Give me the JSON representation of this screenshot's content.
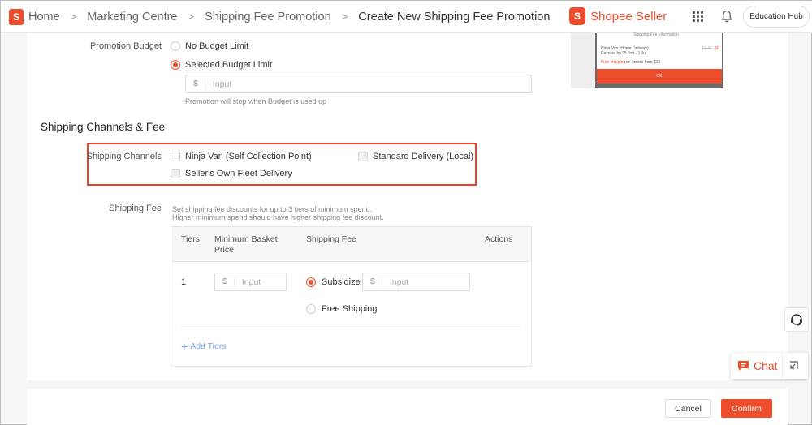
{
  "header": {
    "breadcrumb": [
      "Home",
      "Marketing Centre",
      "Shipping Fee Promotion",
      "Create New Shipping Fee Promotion"
    ],
    "brand": "Shopee Seller",
    "education_hub": "Education Hub"
  },
  "budget": {
    "label": "Promotion Budget",
    "option_no_limit": "No Budget Limit",
    "option_selected": "Selected Budget Limit",
    "currency": "$",
    "placeholder": "Input",
    "hint": "Promotion will stop when Budget is used up"
  },
  "channels_section": {
    "title": "Shipping Channels & Fee",
    "label": "Shipping Channels",
    "options": [
      "Ninja Van (Self Collection Point)",
      "Standard Delivery (Local)",
      "Seller's Own Fleet Delivery"
    ]
  },
  "fee": {
    "label": "Shipping Fee",
    "hint_line1": "Set shipping fee discounts for up to 3 tiers of minimum spend.",
    "hint_line2": "Higher minimum spend should have higher shipping fee discount.",
    "columns": [
      "Tiers",
      "Minimum Basket Price",
      "Shipping Fee",
      "Actions"
    ],
    "row": {
      "tier": "1",
      "currency": "$",
      "basket_placeholder": "Input",
      "subsidize": "Subsidize",
      "fee_placeholder": "Input",
      "free_shipping": "Free Shipping"
    },
    "add_tiers": "Add Tiers"
  },
  "preview": {
    "title": "Shipping Fee Information",
    "channel": "Ninja Van (Home Delivery)",
    "old_price": "$1.49",
    "new_price": "$0",
    "receive": "Receive by 25 Jun - 1 Jul",
    "free_prefix": "Free shipping",
    "free_suffix": "on orders from $15",
    "ok": "OK"
  },
  "widgets": {
    "chat": "Chat"
  },
  "footer": {
    "cancel": "Cancel",
    "confirm": "Confirm"
  },
  "colors": {
    "accent": "#ee4d2d",
    "highlight_border": "#e8432a",
    "link": "#7ea6e0"
  }
}
